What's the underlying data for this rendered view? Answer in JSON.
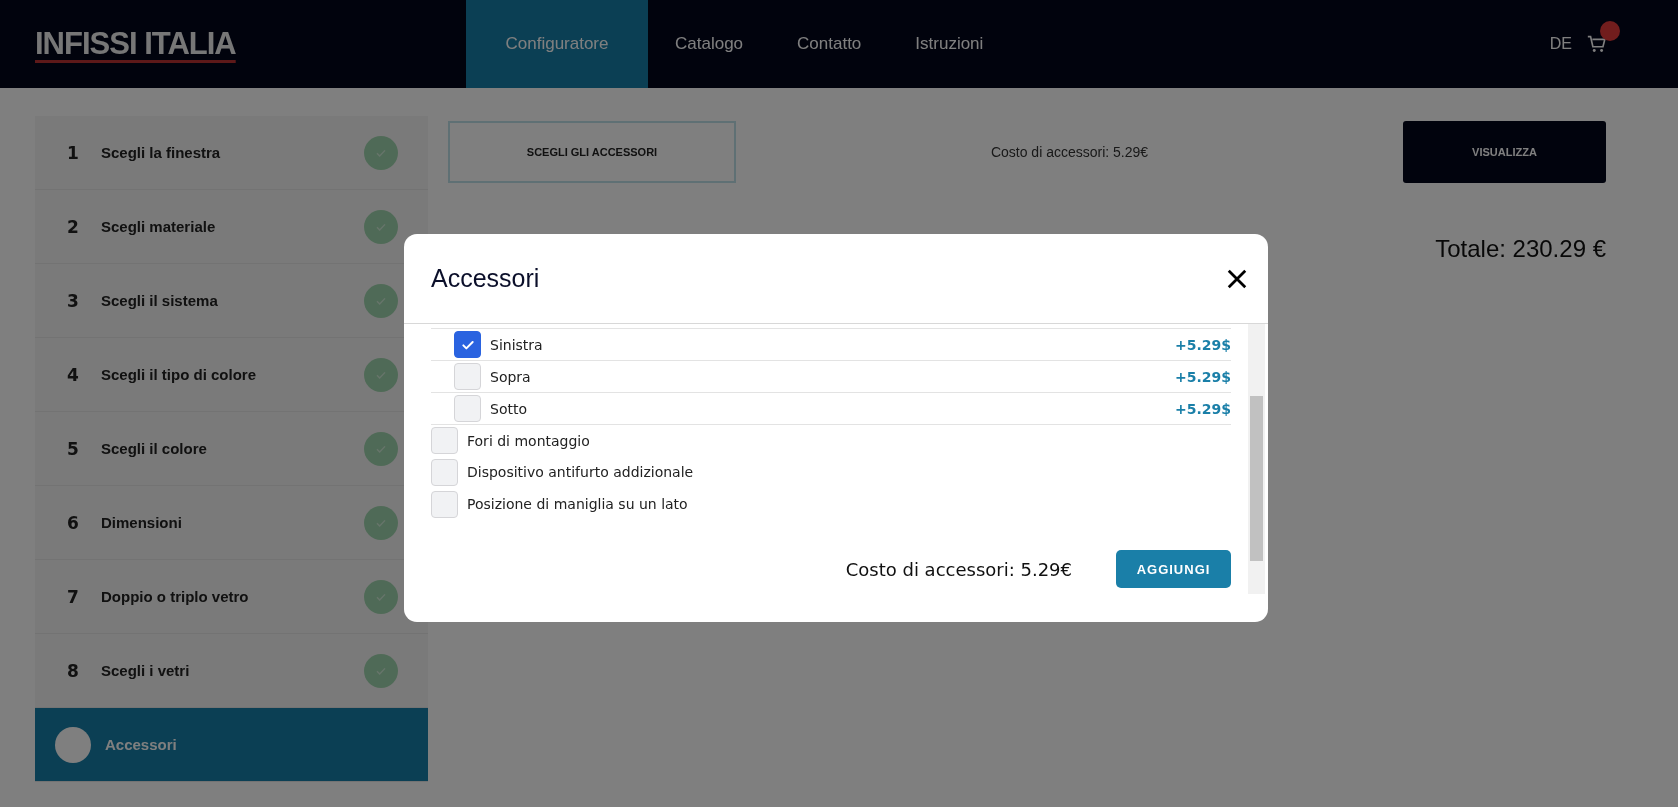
{
  "header": {
    "logo": "INFISSI ITALIA",
    "nav": [
      {
        "label": "Configuratore",
        "selected": true
      },
      {
        "label": "Catalogo",
        "selected": false
      },
      {
        "label": "Contatto",
        "selected": false
      },
      {
        "label": "Istruzioni",
        "selected": false
      }
    ],
    "language": "DE"
  },
  "sidebar": {
    "steps": [
      {
        "number": "1",
        "label": "Scegli la finestra",
        "done": true,
        "selected": false
      },
      {
        "number": "2",
        "label": "Scegli materiale",
        "done": true,
        "selected": false
      },
      {
        "number": "3",
        "label": "Scegli il sistema",
        "done": true,
        "selected": false
      },
      {
        "number": "4",
        "label": "Scegli il tipo di colore",
        "done": true,
        "selected": false
      },
      {
        "number": "5",
        "label": "Scegli il colore",
        "done": true,
        "selected": false
      },
      {
        "number": "6",
        "label": "Dimensioni",
        "done": true,
        "selected": false
      },
      {
        "number": "7",
        "label": "Doppio o triplo vetro",
        "done": true,
        "selected": false
      },
      {
        "number": "8",
        "label": "Scegli i vetri",
        "done": true,
        "selected": false
      },
      {
        "label": "Accessori",
        "done": false,
        "selected": true
      }
    ]
  },
  "main": {
    "choose_button": "SCEGLI GLI ACCESSORI",
    "cost": "Costo di accessori: 5.29€",
    "view_button": "VISUALIZZA",
    "total": "Totale: 230.29 €"
  },
  "modal": {
    "title": "Accessori",
    "options": [
      {
        "children": [
          {
            "label": "Sinistra",
            "checked": true,
            "price": "+5.29$"
          },
          {
            "label": "Sopra",
            "checked": false,
            "price": "+5.29$"
          },
          {
            "label": "Sotto",
            "checked": false,
            "price": "+5.29$"
          }
        ]
      },
      {
        "label": "Fori di montaggio",
        "checked": false
      },
      {
        "label": "Dispositivo antifurto addizionale",
        "checked": false
      },
      {
        "label": "Posizione di maniglia su un lato",
        "checked": false
      }
    ],
    "cost": "Costo di accessori: 5.29€",
    "add_button": "AGGIUNGI"
  }
}
